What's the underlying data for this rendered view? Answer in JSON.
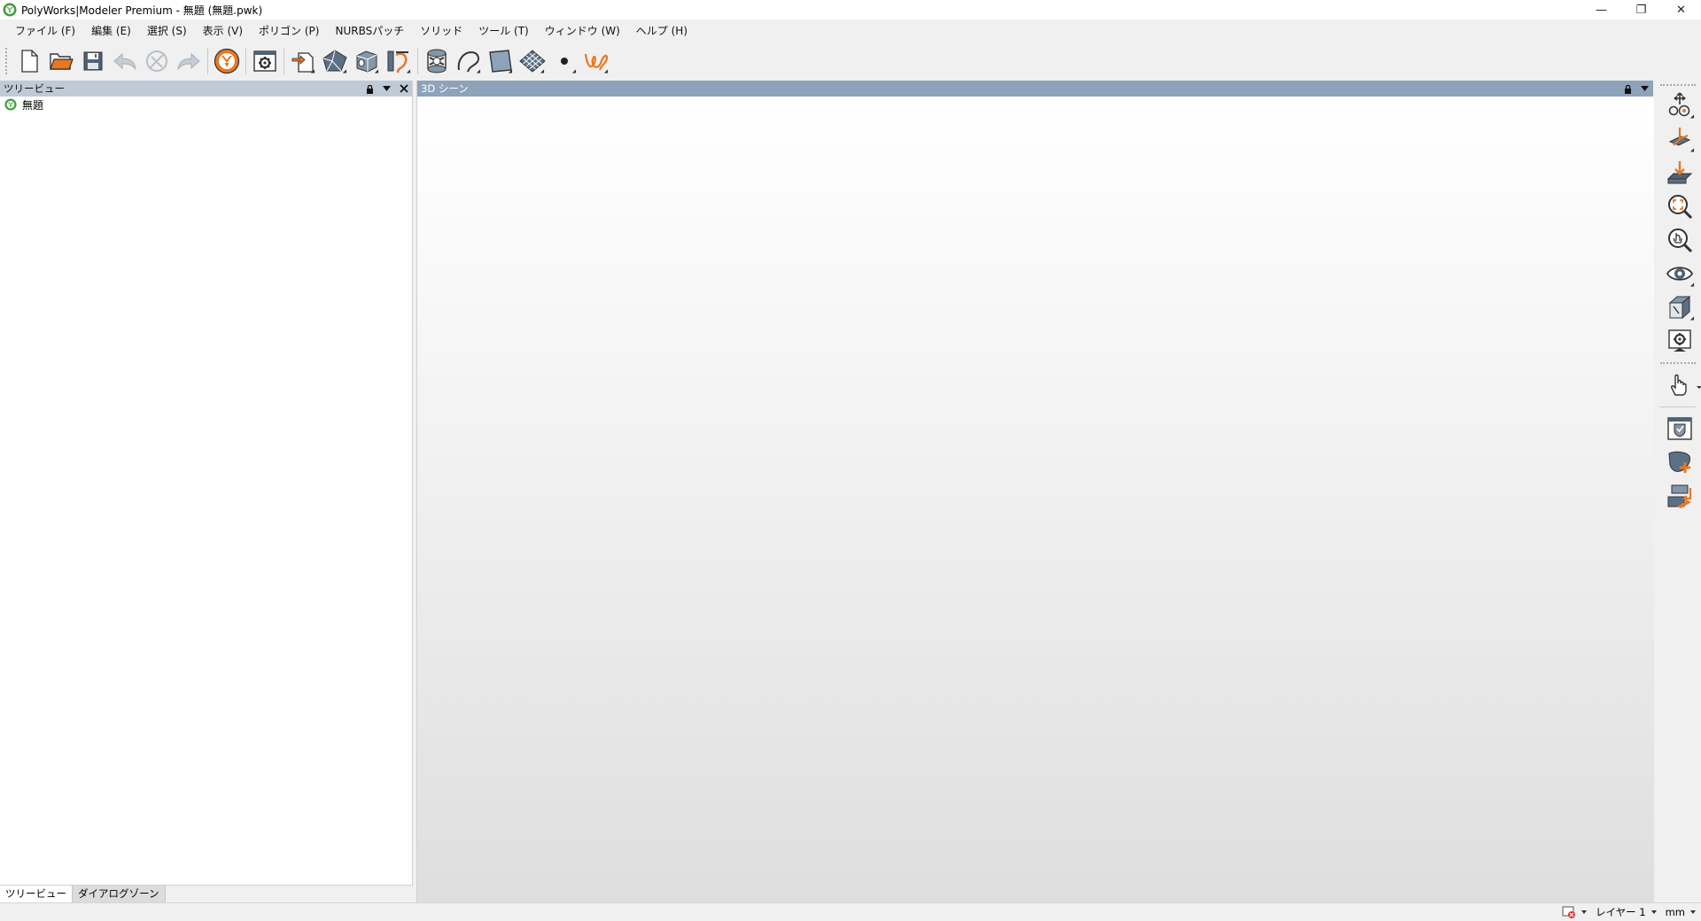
{
  "window": {
    "title": "PolyWorks|Modeler Premium - 無題 (無題.pwk)",
    "minimize_glyph": "—",
    "restore_glyph": "❐",
    "close_glyph": "✕"
  },
  "menu": [
    {
      "label": "ファイル (F)"
    },
    {
      "label": "編集 (E)"
    },
    {
      "label": "選択 (S)"
    },
    {
      "label": "表示 (V)"
    },
    {
      "label": "ポリゴン (P)"
    },
    {
      "label": "NURBSパッチ"
    },
    {
      "label": "ソリッド"
    },
    {
      "label": "ツール (T)"
    },
    {
      "label": "ウィンドウ (W)"
    },
    {
      "label": "ヘルプ (H)"
    }
  ],
  "toolbar": {
    "icons": [
      "new-file-icon",
      "open-folder-icon",
      "save-icon",
      "undo-icon",
      "clear-history-icon",
      "redo-icon",
      "polyworks-workspace-icon",
      "options-settings-icon",
      "import-icon",
      "polygon-object-icon",
      "solid-object-icon",
      "curve-tool-icon",
      "feature-tool-icon",
      "curve-arc-icon",
      "patch-surface-icon",
      "mesh-grid-icon",
      "point-icon",
      "sketch-icon"
    ]
  },
  "tree_panel": {
    "title": "ツリービュー",
    "root_item": "無題",
    "tabs": [
      {
        "label": "ツリービュー",
        "active": true
      },
      {
        "label": "ダイアログゾーン",
        "active": false
      }
    ]
  },
  "scene_panel": {
    "title": "3D シーン"
  },
  "right_toolbar": {
    "icons": [
      "transform-icon",
      "align-view-icon",
      "view-from-top-icon",
      "zoom-fit-icon",
      "zoom-interactive-icon",
      "visibility-eye-icon",
      "view-cube-icon",
      "view-settings-icon",
      "selection-hand-icon",
      "object-shield-icon",
      "add-object-icon",
      "replace-object-icon"
    ]
  },
  "status": {
    "layer_label": "レイヤー 1",
    "units": "mm"
  },
  "colors": {
    "accent_orange": "#e87722",
    "panel_header_active": "#8ea3ba",
    "panel_header_inactive": "#bfcad7",
    "icon_blue_grey": "#4f6277"
  }
}
